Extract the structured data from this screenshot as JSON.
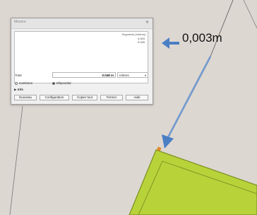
{
  "dialog": {
    "title": "Mesure",
    "close_icon": "close-icon",
    "list_header": "Segments [mètres]",
    "segments": [
      "0.003",
      "0.045"
    ],
    "total_label": "Total",
    "total_value": "0.048 m",
    "unit": "mètres",
    "radio_cartesian": "Cartésien",
    "radio_ellipsoidal": "Ellipsoïdal",
    "selected_mode": "Ellipsoïdal",
    "info_label": "Info",
    "buttons": {
      "new": "Nouveau",
      "config": "Configuration",
      "copy_all": "Copier tout",
      "close": "Fermer",
      "help": "Aide"
    }
  },
  "callout": {
    "text": "0,003m",
    "arrow_color": "#4a7fc4"
  },
  "colors": {
    "map_bg": "#ddd7d1",
    "polygon_fill": "#b8d23a",
    "polygon_edge": "#7a8f1f",
    "line_color": "#555555"
  }
}
